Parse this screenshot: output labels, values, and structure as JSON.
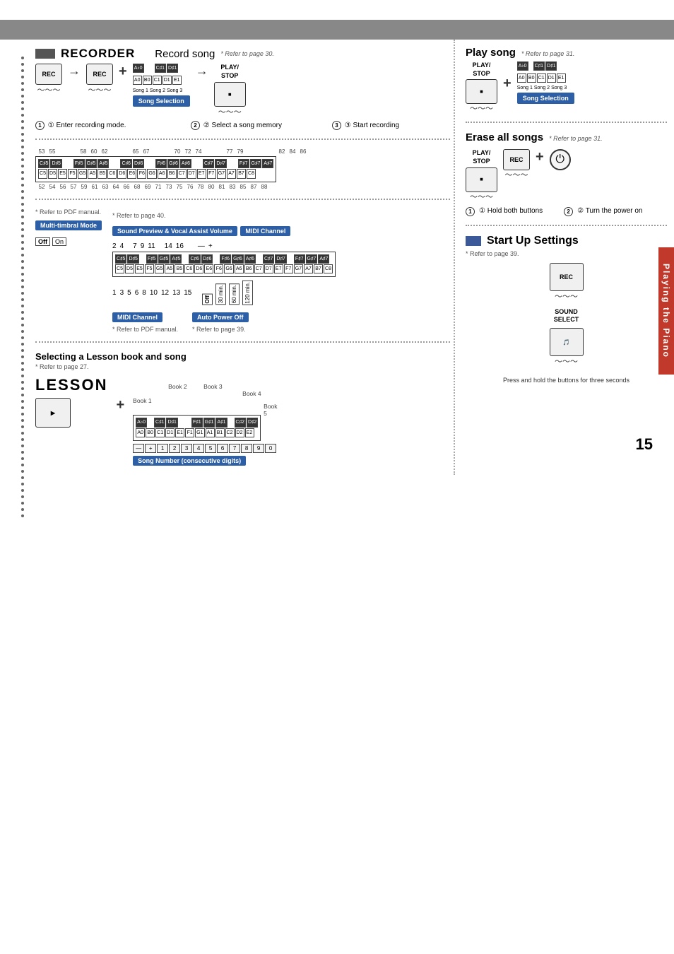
{
  "page": {
    "number": "15",
    "tab_label": "Playing the Piano",
    "top_bar_color": "#888888"
  },
  "recorder_section": {
    "color_block": "■",
    "title": "RECORDER",
    "record_song_title": "Record song",
    "record_song_ref": "* Refer to page 30.",
    "step1_label": "① Enter recording mode.",
    "step2_label": "② Select a song memory",
    "step3_label": "③ Start recording",
    "rec_button": "REC",
    "play_stop": "PLAY/\nSTOP",
    "song_selection": "Song Selection",
    "song_keys": {
      "black_row": [
        "A♭0",
        "C♯1",
        "D♯1"
      ],
      "white_row": [
        "A0",
        "B0",
        "C1",
        "D1",
        "E1"
      ],
      "song_labels": [
        "Song 1",
        "Song 2",
        "Song 3"
      ]
    }
  },
  "piano_keyboard": {
    "top_numbers": [
      "53",
      "55",
      "",
      "58",
      "60",
      "62",
      "",
      "65",
      "67",
      "",
      "70",
      "72",
      "74",
      "",
      "77",
      "79",
      "",
      "",
      "82",
      "84",
      "86"
    ],
    "black_keys": [
      "C♯5",
      "D♯5",
      "",
      "F♯5",
      "G♯5",
      "A♯5",
      "",
      "C♯6",
      "D♯6",
      "",
      "F♯6",
      "G♯6",
      "A♯6",
      "",
      "C♯7",
      "D♯7",
      "",
      "F♯7",
      "G♯7",
      "A♯7"
    ],
    "white_keys": [
      "C5",
      "D5",
      "E5",
      "F5",
      "G5",
      "A5",
      "B5",
      "C6",
      "D6",
      "E6",
      "F6",
      "G6",
      "A6",
      "B6",
      "C7",
      "D7",
      "E7",
      "F7",
      "G7",
      "A7",
      "B7",
      "C8"
    ],
    "bottom_numbers": [
      "52",
      "54",
      "56",
      "57",
      "59",
      "61",
      "63",
      "64",
      "66",
      "68",
      "69",
      "71",
      "73",
      "75",
      "76",
      "78",
      "80",
      "81",
      "83",
      "85",
      "87",
      "88"
    ]
  },
  "play_song_section": {
    "title": "Play song",
    "ref": "* Refer to page 31.",
    "song_selection": "Song Selection",
    "play_stop": "PLAY/\nSTOP"
  },
  "erase_section": {
    "title": "Erase all songs",
    "ref": "* Refer to page 31.",
    "step1": "① Hold both buttons",
    "step2": "② Turn the power on",
    "play_stop": "PLAY/\nSTOP",
    "rec_button": "REC"
  },
  "sound_preview_section": {
    "ref": "* Refer to page 40.",
    "title": "Sound Preview & Vocal Assist Volume",
    "pdf_ref": "* Refer to PDF manual.",
    "multi_timbral": "Multi-timbral Mode",
    "midi_channel": "MIDI Channel",
    "midi_channel_footer": "MIDI Channel",
    "midi_pdf_ref": "* Refer to PDF manual.",
    "auto_power_off": "Auto Power Off",
    "auto_power_ref": "* Refer to page 39.",
    "off_label": "Off",
    "on_label": "On",
    "numbers_top": [
      "2",
      "4",
      "7",
      "9",
      "11",
      "14",
      "16"
    ],
    "numbers_bottom": [
      "1",
      "3",
      "5",
      "6",
      "8",
      "10",
      "12",
      "13",
      "15"
    ],
    "power_times": [
      "Off",
      "30 min.",
      "60 min.",
      "120 min."
    ],
    "minus_plus": [
      "—",
      "+"
    ]
  },
  "lesson_section": {
    "title": "Selecting a Lesson book and song",
    "ref": "* Refer to page 27.",
    "lesson_label": "LESSON",
    "book_labels": [
      "Book 1",
      "Book 2",
      "Book 3",
      "Book 4",
      "Book 5"
    ],
    "black_keys": [
      "A♭0",
      "C♯1",
      "D♯1",
      "",
      "F♯1",
      "G♯1",
      "A♯1",
      "",
      "C♯2",
      "D♯2"
    ],
    "white_keys": [
      "A0",
      "B0",
      "C1",
      "D1",
      "E1",
      "F1",
      "G1",
      "A1",
      "B1",
      "C2",
      "D2",
      "E2"
    ],
    "song_num_label": "Song Number (consecutive digits)",
    "num_keys": [
      "—",
      "+",
      "1",
      "2",
      "3",
      "4",
      "5",
      "6",
      "7",
      "8",
      "9",
      "0"
    ]
  },
  "startup_section": {
    "color_block": "■",
    "title": "Start Up Settings",
    "ref": "* Refer to page 39.",
    "rec_button": "REC",
    "sound_select_label": "SOUND\nSELECT",
    "press_hold_text": "Press and hold the buttons\nfor three seconds"
  }
}
